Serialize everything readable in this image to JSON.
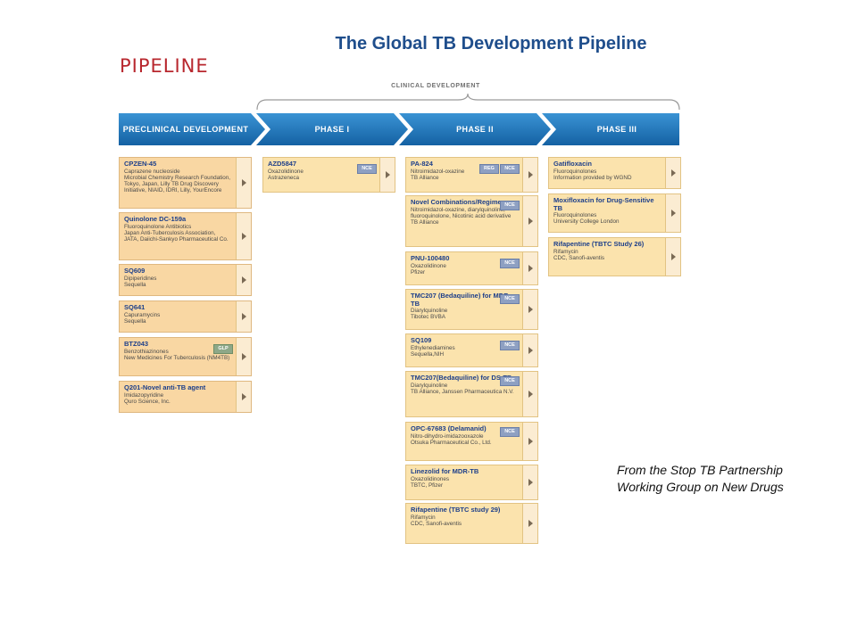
{
  "slide": {
    "title": "The Global TB Development Pipeline",
    "pipeline_heading": "PIPELINE",
    "clinical_label": "CLINICAL DEVELOPMENT",
    "source_note": "From the Stop TB Partnership Working Group on New Drugs"
  },
  "colors": {
    "title_blue": "#1f4e8c",
    "heading_red": "#b8272e",
    "phase_blue": "#1f73b5",
    "card_fill": "#fbe3ad",
    "drug_name_blue": "#1d3f8a"
  },
  "phases": [
    "PRECLINICAL DEVELOPMENT",
    "PHASE I",
    "PHASE II",
    "PHASE III"
  ],
  "preclinical": [
    {
      "name": "CPZEN-45",
      "lines": [
        "Caprazene nucleoside",
        "Microbial Chemistry Research Foundation, Tokyo, Japan, Lilly TB Drug Discovery Initiative, NIAID, IDRI, Lilly, YourEncore"
      ],
      "tag": ""
    },
    {
      "name": "Quinolone DC-159a",
      "lines": [
        "Fluoroquinolone Antibiotics",
        "Japan Anti-Tuberculosis Association, JATA, Daiichi-Sankyo Pharmaceutical Co."
      ],
      "tag": ""
    },
    {
      "name": "SQ609",
      "lines": [
        "Dipiperidines",
        "Sequella"
      ],
      "tag": ""
    },
    {
      "name": "SQ641",
      "lines": [
        "Capuramycins",
        "Sequella"
      ],
      "tag": ""
    },
    {
      "name": "BTZ043",
      "lines": [
        "Benzothiazinones",
        "New Medicines For Tuberculosis (NM4TB)"
      ],
      "tag": "GLP"
    },
    {
      "name": "Q201-Novel anti-TB agent",
      "lines": [
        "Imidazopyridine",
        "Quro Science, Inc."
      ],
      "tag": ""
    }
  ],
  "phase1": [
    {
      "name": "AZD5847",
      "lines": [
        "Oxazolidinone",
        "Astrazeneca"
      ],
      "tag": "NCE"
    }
  ],
  "phase2": [
    {
      "name": "PA-824",
      "lines": [
        "Nitroimidazol-oxazine",
        "TB Alliance"
      ],
      "tag": "NCE",
      "tag2": "REG"
    },
    {
      "name": "Novel Combinations/Regimens",
      "lines": [
        "Nitroimidazol-oxazine, diarylquinoline, fluoroquinolone, Nicotinic acid derivative",
        "TB Alliance"
      ],
      "tag": "NCE"
    },
    {
      "name": "PNU-100480",
      "lines": [
        "Oxazolidinone",
        "Pfizer"
      ],
      "tag": "NCE"
    },
    {
      "name": "TMC207 (Bedaquiline) for MDR-TB",
      "lines": [
        "Diarylquinoline",
        "Tibotec BVBA"
      ],
      "tag": "NCE"
    },
    {
      "name": "SQ109",
      "lines": [
        "Ethylenediamines",
        "Sequella,NIH"
      ],
      "tag": "NCE"
    },
    {
      "name": "TMC207(Bedaquiline) for DS-TB",
      "lines": [
        "Diarylquinoline",
        "TB Alliance, Janssen Pharmaceutica N.V."
      ],
      "tag": "NCE"
    },
    {
      "name": "OPC-67683 (Delamanid)",
      "lines": [
        "Nitro-dihydro-imidazooxazole",
        "Otsuka Pharmaceutical Co., Ltd."
      ],
      "tag": "NCE"
    },
    {
      "name": "Linezolid for MDR-TB",
      "lines": [
        "Oxazolidinones",
        "TBTC, Pfizer"
      ],
      "tag": ""
    },
    {
      "name": "Rifapentine (TBTC study 29)",
      "lines": [
        "Rifamycin",
        "CDC, Sanofi-aventis"
      ],
      "tag": ""
    }
  ],
  "phase3": [
    {
      "name": "Gatifloxacin",
      "lines": [
        "Fluoroquinolones",
        "Information provided by WGND"
      ],
      "tag": ""
    },
    {
      "name": "Moxifloxacin for Drug-Sensitive TB",
      "lines": [
        "Fluoroquinolones",
        "University College London"
      ],
      "tag": ""
    },
    {
      "name": "Rifapentine (TBTC Study 26)",
      "lines": [
        "Rifamycin",
        "CDC, Sanofi-aventis"
      ],
      "tag": ""
    }
  ]
}
